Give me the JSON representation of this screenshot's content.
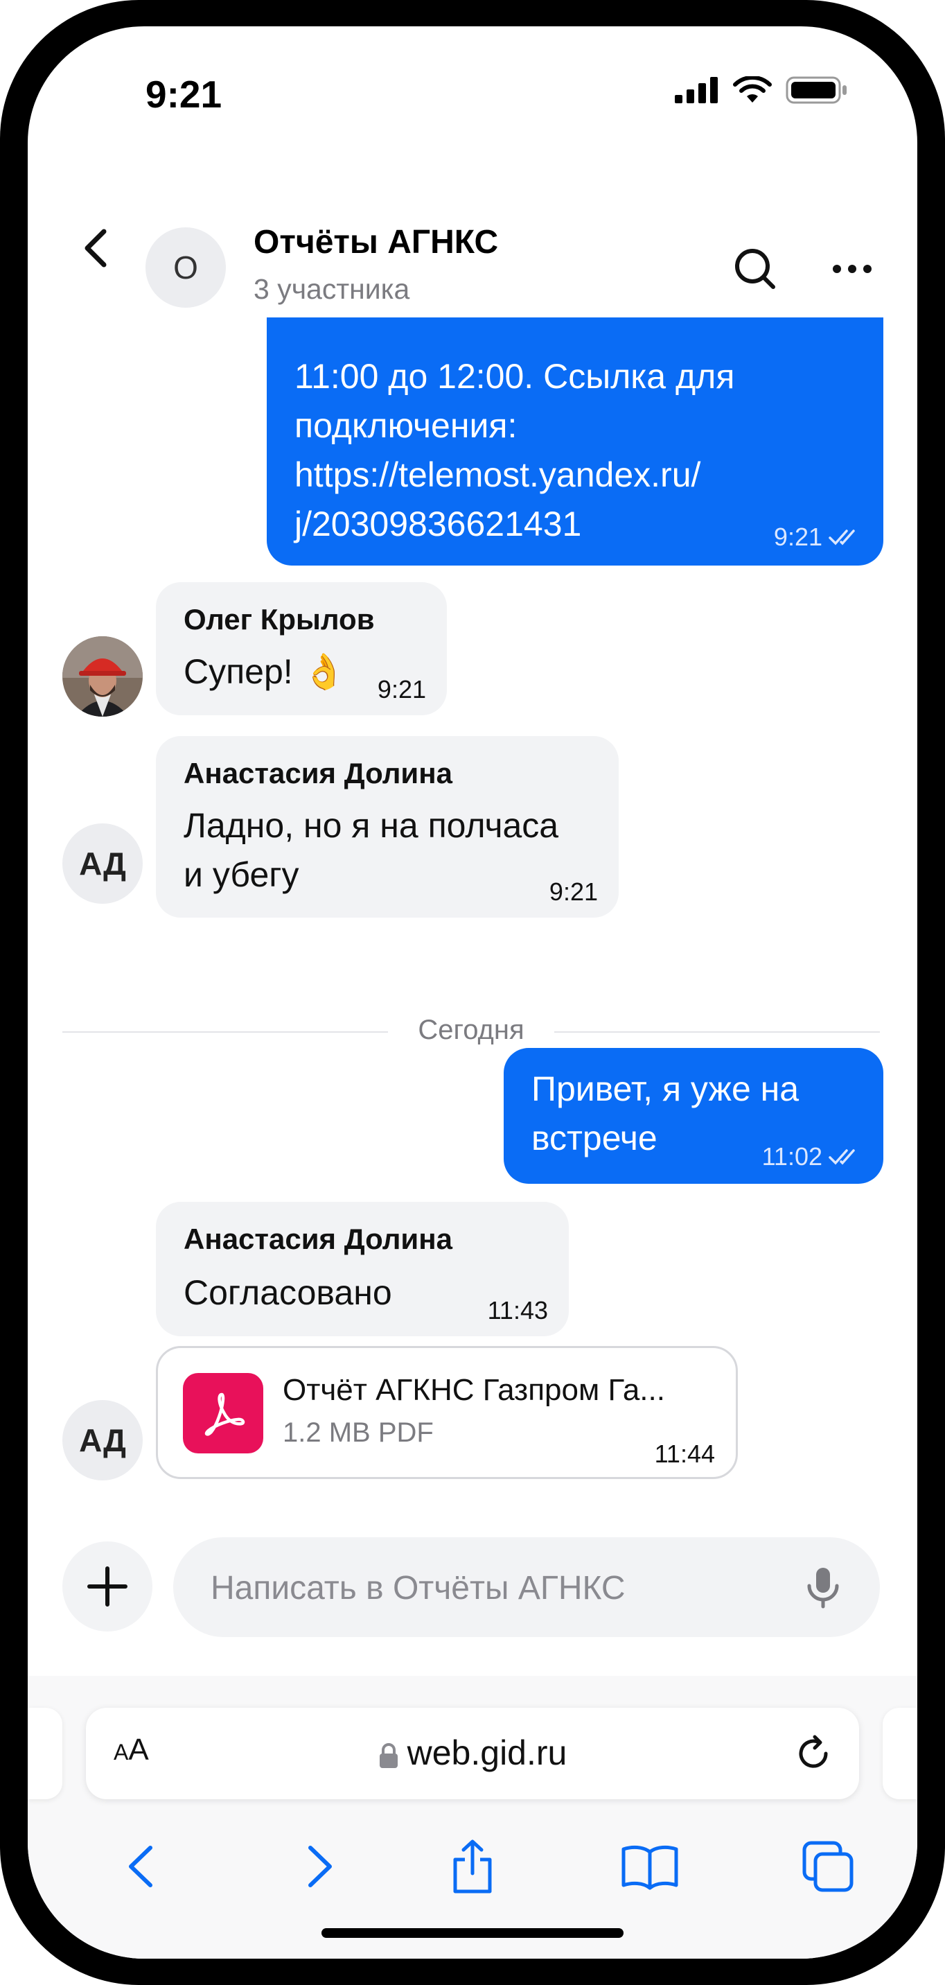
{
  "status_bar": {
    "time": "9:21"
  },
  "header": {
    "avatar_letter": "О",
    "title": "Отчёты АГНКС",
    "subtitle": "3 участника"
  },
  "messages": {
    "m1": {
      "text": "11:00 до 12:00. Ссылка для\nподключения:\nhttps://telemost.yandex.ru/\nj/20309836621431",
      "time": "9:21"
    },
    "m2": {
      "sender": "Олег Крылов",
      "text": "Супер! 👌",
      "time": "9:21"
    },
    "m3": {
      "sender": "Анастасия Долина",
      "avatar": "АД",
      "text": "Ладно, но я на полчаса\nи убегу",
      "time": "9:21"
    },
    "date_separator": "Сегодня",
    "m4": {
      "text": "Привет, я уже на\nвстрече",
      "time": "11:02"
    },
    "m5": {
      "sender": "Анастасия Долина",
      "text": "Согласовано",
      "time": "11:43"
    },
    "m6": {
      "avatar": "АД",
      "file_name": "Отчёт АГКНС Газпром Га...",
      "file_meta": "1.2 MB PDF",
      "time": "11:44"
    }
  },
  "composer": {
    "placeholder": "Написать в Отчёты АГНКС"
  },
  "browser": {
    "aa_small": "A",
    "aa_large": "A",
    "url": "web.gid.ru"
  },
  "colors": {
    "accent": "#0a6cf5",
    "pdf": "#e8115a",
    "incoming": "#f2f3f5"
  }
}
